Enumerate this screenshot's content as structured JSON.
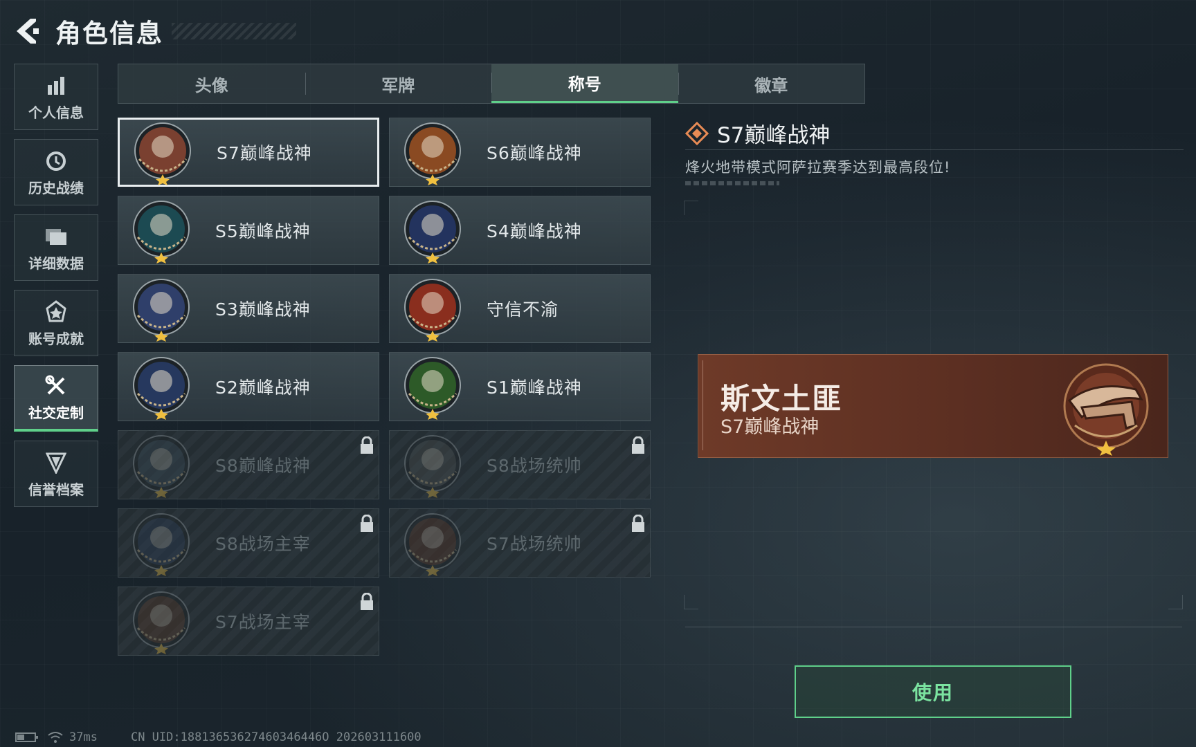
{
  "header": {
    "title": "角色信息"
  },
  "sidebar": {
    "items": [
      {
        "label": "个人信息",
        "icon": "bar-chart-icon"
      },
      {
        "label": "历史战绩",
        "icon": "history-clock-icon"
      },
      {
        "label": "详细数据",
        "icon": "folder-icon"
      },
      {
        "label": "账号成就",
        "icon": "achievement-icon"
      },
      {
        "label": "社交定制",
        "icon": "tools-icon",
        "active": true
      },
      {
        "label": "信誉档案",
        "icon": "shield-icon"
      }
    ]
  },
  "tabs": [
    {
      "label": "头像"
    },
    {
      "label": "军牌"
    },
    {
      "label": "称号",
      "active": true
    },
    {
      "label": "徽章"
    }
  ],
  "titles": [
    {
      "name": "S7巅峰战神",
      "badge": "crossbow-badge",
      "color": "#7a4030",
      "locked": false,
      "selected": true
    },
    {
      "name": "S6巅峰战神",
      "badge": "t-shield-badge",
      "color": "#8a4a22",
      "locked": false
    },
    {
      "name": "S5巅峰战神",
      "badge": "diver-skull-badge",
      "color": "#1c4a52",
      "locked": false
    },
    {
      "name": "S4巅峰战神",
      "badge": "tactical-helmet-badge",
      "color": "#23335e",
      "locked": false
    },
    {
      "name": "S3巅峰战神",
      "badge": "globe-badge",
      "color": "#2f3f6a",
      "locked": false
    },
    {
      "name": "守信不渝",
      "badge": "scales-badge",
      "color": "#8a2e1e",
      "locked": false
    },
    {
      "name": "S2巅峰战神",
      "badge": "triangle-eye-badge",
      "color": "#26385e",
      "locked": false
    },
    {
      "name": "S1巅峰战神",
      "badge": "crocodile-badge",
      "color": "#2d5a28",
      "locked": false
    },
    {
      "name": "S8巅峰战神",
      "badge": "slash-badge",
      "color": "#3a4a58",
      "locked": true
    },
    {
      "name": "S8战场统帅",
      "badge": "tank-badge",
      "color": "#4a4e4e",
      "locked": true
    },
    {
      "name": "S8战场主宰",
      "badge": "building-badge",
      "color": "#2c3e58",
      "locked": true
    },
    {
      "name": "S7战场统帅",
      "badge": "armored-car-badge",
      "color": "#5a3424",
      "locked": true
    },
    {
      "name": "S7战场主宰",
      "badge": "warrior-badge",
      "color": "#5a3a28",
      "locked": true
    }
  ],
  "detail": {
    "title": "S7巅峰战神",
    "description": "烽火地带模式阿萨拉赛季达到最高段位!"
  },
  "preview": {
    "player_name": "斯文土匪",
    "title": "S7巅峰战神"
  },
  "actions": {
    "use_label": "使用"
  },
  "status": {
    "ping": "37ms",
    "uid": "CN UID:18813653627460346446O 202603111600"
  },
  "colors": {
    "accent": "#5fd08a",
    "preview_bg": "#6e3a28"
  }
}
